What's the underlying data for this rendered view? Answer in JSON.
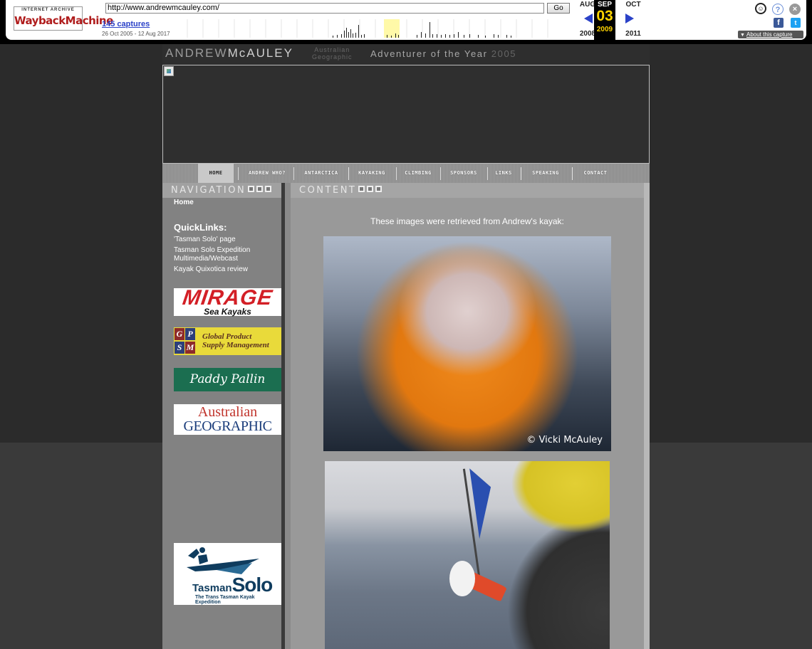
{
  "wayback": {
    "logo_top": "INTERNET ARCHIVE",
    "logo_main": "WaybackMachine",
    "url": "http://www.andrewmcauley.com/",
    "go_label": "Go",
    "captures": "145 captures",
    "range": "26 Oct 2005 - 12 Aug 2017",
    "prev_month": "AUG",
    "prev_year": "2008",
    "cur_month": "SEP",
    "cur_day": "03",
    "cur_year": "2009",
    "next_month": "OCT",
    "next_year": "2011",
    "about": "About this capture",
    "icons": [
      "user-icon",
      "help-icon",
      "close-icon",
      "facebook-icon",
      "twitter-icon"
    ]
  },
  "header": {
    "name_light": "ANDREW",
    "name_bold": "McAULEY",
    "ag_line1": "Australian",
    "ag_line2": "Geographic",
    "award": "Adventurer of the Year",
    "award_year": "2005"
  },
  "nav": {
    "items": [
      {
        "label": "HOME"
      },
      {
        "label": "ANDREW WHO?"
      },
      {
        "label": "ANTARCTICA"
      },
      {
        "label": "KAYAKING"
      },
      {
        "label": "CLIMBING"
      },
      {
        "label": "SPONSORS"
      },
      {
        "label": "LINKS"
      },
      {
        "label": "SPEAKING"
      },
      {
        "label": "CONTACT"
      }
    ]
  },
  "sections": {
    "navigation": "NAVIGATION",
    "content": "CONTENT"
  },
  "sidebar": {
    "home": "Home",
    "quicklinks_title": "QuickLinks:",
    "links": [
      {
        "label": "'Tasman Solo' page"
      },
      {
        "label": "Tasman Solo Expedition Multimedia/Webcast"
      },
      {
        "label": "Kayak Quixotica review"
      }
    ]
  },
  "sponsors": {
    "mirage_1": "MIRAGE",
    "mirage_2": "Sea Kayaks",
    "gpsm_letters": [
      "G",
      "P",
      "S",
      "M"
    ],
    "gpsm_1": "Global Product",
    "gpsm_2": "Supply Management",
    "paddy": "Paddy Pallin",
    "ag_1": "Australian",
    "ag_2": "GEOGRAPHIC",
    "tasman_main": "Tasman",
    "tasman_solo": "Solo",
    "tasman_sub": "The Trans Tasman Kayak Expedition"
  },
  "content": {
    "caption": "These images were retrieved from Andrew's kayak:",
    "photo1_credit": "© Vicki McAuley"
  }
}
